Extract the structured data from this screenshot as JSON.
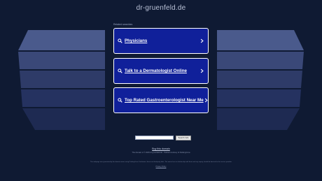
{
  "header": {
    "domain": "dr-gruenfeld.de"
  },
  "related": {
    "label": "Related searches",
    "items": [
      {
        "label": "Physicians"
      },
      {
        "label": "Talk to a Dermatologist Online"
      },
      {
        "label": "Top Rated Gastroenterologist Near Me"
      }
    ]
  },
  "search": {
    "placeholder": "",
    "button_label": "Search Ads"
  },
  "footer": {
    "buy_link": "Buy this domain",
    "copyright": "The domain is © 2025 dr-gruenfeld.de · Parked courtesy of ParkingCrew",
    "disclaimer": "This webpage was generated by the domain owner using ParkingCrew. Disclaimer: these are third-party links. The owner has no relationship with them and any inquiry should be directed to the service provider.",
    "privacy_link": "Privacy Policy"
  },
  "colors": {
    "background": "#0f1a33",
    "card": "#10209a",
    "card_border": "#ffffff",
    "deco_light": "#4a5a8c",
    "deco_dark": "#1e2a52"
  }
}
